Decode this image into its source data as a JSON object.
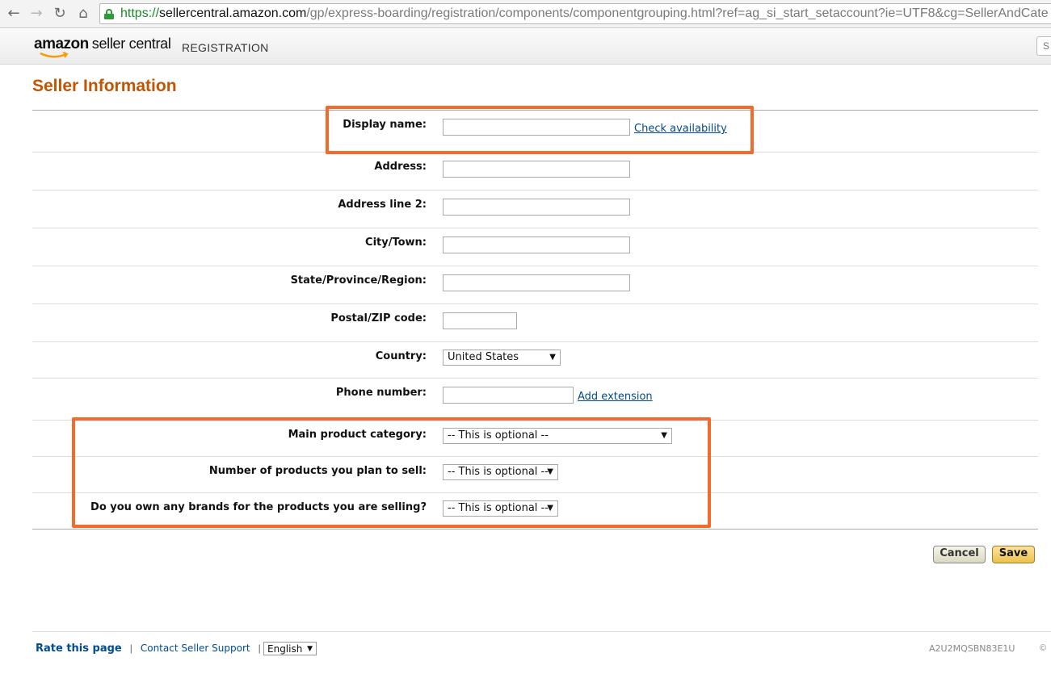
{
  "browser": {
    "url_scheme": "https://",
    "url_host": "sellercentral.amazon.com",
    "url_path": "/gp/express-boarding/registration/components/componentgrouping.html?ref=ag_si_start_setaccount?ie=UTF8&cg=SellerAndCate",
    "back_icon": "back-arrow-icon",
    "forward_icon": "forward-arrow-icon",
    "reload_icon": "reload-icon",
    "home_icon": "home-icon"
  },
  "header": {
    "logo_amazon": "amazon",
    "logo_product": "seller central",
    "section": "REGISTRATION",
    "search_partial": "S"
  },
  "page": {
    "title": "Seller Information"
  },
  "form": {
    "display_name": {
      "label": "Display name:",
      "value": "",
      "link": "Check availability"
    },
    "address": {
      "label": "Address:",
      "value": ""
    },
    "address2": {
      "label": "Address line 2:",
      "value": ""
    },
    "city": {
      "label": "City/Town:",
      "value": ""
    },
    "state": {
      "label": "State/Province/Region:",
      "value": ""
    },
    "postal": {
      "label": "Postal/ZIP code:",
      "value": ""
    },
    "country": {
      "label": "Country:",
      "selected": "United States"
    },
    "phone": {
      "label": "Phone number:",
      "value": "",
      "link": "Add extension"
    },
    "category": {
      "label": "Main product category:",
      "selected": "-- This is optional --"
    },
    "num_products": {
      "label": "Number of products you plan to sell:",
      "selected": "-- This is optional --"
    },
    "brands": {
      "label": "Do you own any brands for the products you are selling?",
      "selected": "-- This is optional --"
    }
  },
  "buttons": {
    "cancel": "Cancel",
    "save": "Save"
  },
  "footer": {
    "rate": "Rate this page",
    "separator": "|",
    "contact": "Contact Seller Support",
    "language": "English",
    "merchant_id": "A2U2MQSBN83E1U",
    "copyright": "©"
  },
  "colors": {
    "title": "#c45500",
    "highlight": "#f36b2c",
    "link": "#004b91",
    "save_button": "#f0c14b"
  }
}
